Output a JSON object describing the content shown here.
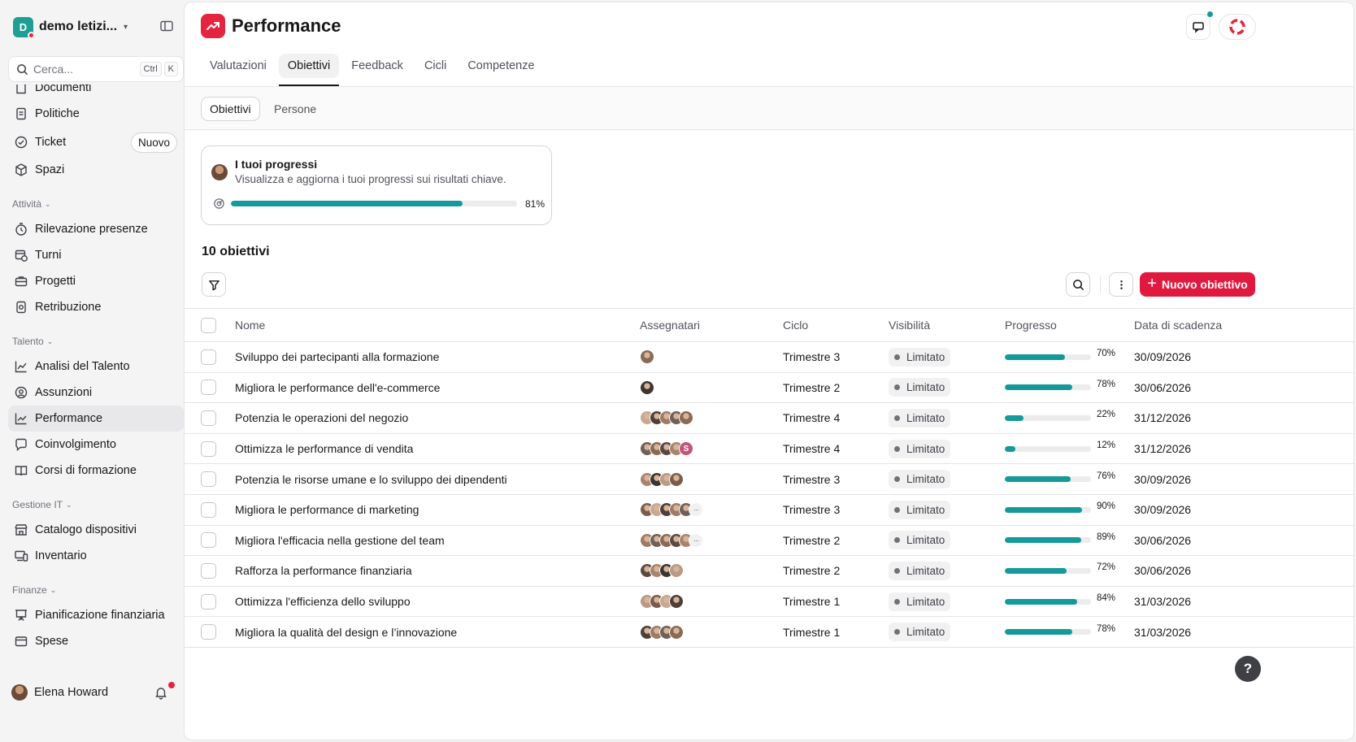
{
  "workspace": {
    "initial": "D",
    "name": "demo letizi..."
  },
  "search": {
    "placeholder": "Cerca...",
    "kbd1": "Ctrl",
    "kbd2": "K"
  },
  "sidebar": {
    "items": [
      {
        "label": "Documenti",
        "icon": "document-icon"
      },
      {
        "label": "Politiche",
        "icon": "policy-icon"
      },
      {
        "label": "Ticket",
        "icon": "check-circle-icon",
        "badge": "Nuovo"
      },
      {
        "label": "Spazi",
        "icon": "cube-icon"
      },
      {
        "label": "Rilevazione presenze",
        "icon": "timer-icon"
      },
      {
        "label": "Turni",
        "icon": "calendar-clock-icon"
      },
      {
        "label": "Progetti",
        "icon": "briefcase-icon"
      },
      {
        "label": "Retribuzione",
        "icon": "money-icon"
      },
      {
        "label": "Analisi del Talento",
        "icon": "chart-line-icon"
      },
      {
        "label": "Assunzioni",
        "icon": "user-search-icon"
      },
      {
        "label": "Performance",
        "icon": "trend-icon"
      },
      {
        "label": "Coinvolgimento",
        "icon": "chat-heart-icon"
      },
      {
        "label": "Corsi di formazione",
        "icon": "book-icon"
      },
      {
        "label": "Catalogo dispositivi",
        "icon": "store-icon"
      },
      {
        "label": "Inventario",
        "icon": "devices-icon"
      },
      {
        "label": "Pianificazione finanziaria",
        "icon": "presentation-icon"
      },
      {
        "label": "Spese",
        "icon": "wallet-icon"
      }
    ],
    "sections": {
      "attivita": "Attività",
      "talento": "Talento",
      "gestione_it": "Gestione IT",
      "finanze": "Finanze"
    }
  },
  "user": {
    "name": "Elena Howard"
  },
  "header": {
    "title": "Performance",
    "tabs": [
      "Valutazioni",
      "Obiettivi",
      "Feedback",
      "Cicli",
      "Competenze"
    ],
    "active_tab": "Obiettivi"
  },
  "subtabs": [
    "Obiettivi",
    "Persone"
  ],
  "progress_card": {
    "title": "I tuoi progressi",
    "subtitle": "Visualizza e aggiorna i tuoi progressi sui risultati chiave.",
    "percent": 81,
    "percent_label": "81%"
  },
  "count_label": "10 obiettivi",
  "new_button_label": "Nuovo obiettivo",
  "colors": {
    "accent": "#e01a3f",
    "progress": "#159a99"
  },
  "table": {
    "columns": [
      "Nome",
      "Assegnatari",
      "Ciclo",
      "Visibilità",
      "Progresso",
      "Data di scadenza"
    ],
    "rows": [
      {
        "name": "Sviluppo dei partecipanti alla formazione",
        "assignees": [
          "p1"
        ],
        "cycle": "Trimestre 3",
        "visibility": "Limitato",
        "progress": 70,
        "progress_label": "70%",
        "due": "30/09/2026"
      },
      {
        "name": "Migliora le performance dell'e-commerce",
        "assignees": [
          "p2"
        ],
        "cycle": "Trimestre 2",
        "visibility": "Limitato",
        "progress": 78,
        "progress_label": "78%",
        "due": "30/06/2026"
      },
      {
        "name": "Potenzia le operazioni del negozio",
        "assignees": [
          "p3",
          "p4",
          "p5",
          "p6",
          "p7"
        ],
        "cycle": "Trimestre 4",
        "visibility": "Limitato",
        "progress": 22,
        "progress_label": "22%",
        "due": "31/12/2026"
      },
      {
        "name": "Ottimizza le performance di vendita",
        "assignees": [
          "p8",
          "p9",
          "p10",
          "p11",
          "S"
        ],
        "cycle": "Trimestre 4",
        "visibility": "Limitato",
        "progress": 12,
        "progress_label": "12%",
        "due": "31/12/2026"
      },
      {
        "name": "Potenzia le risorse umane e lo sviluppo dei dipendenti",
        "assignees": [
          "p12",
          "p13",
          "p14",
          "p15"
        ],
        "cycle": "Trimestre 3",
        "visibility": "Limitato",
        "progress": 76,
        "progress_label": "76%",
        "due": "30/09/2026"
      },
      {
        "name": "Migliora le performance di marketing",
        "assignees": [
          "p16",
          "p17",
          "p18",
          "p19",
          "p20",
          "..."
        ],
        "cycle": "Trimestre 3",
        "visibility": "Limitato",
        "progress": 90,
        "progress_label": "90%",
        "due": "30/09/2026"
      },
      {
        "name": "Migliora l'efficacia nella gestione del team",
        "assignees": [
          "p21",
          "p22",
          "p23",
          "p24",
          "p25",
          "..."
        ],
        "cycle": "Trimestre 2",
        "visibility": "Limitato",
        "progress": 89,
        "progress_label": "89%",
        "due": "30/06/2026"
      },
      {
        "name": "Rafforza la performance finanziaria",
        "assignees": [
          "p26",
          "p27",
          "p28",
          "p29"
        ],
        "cycle": "Trimestre 2",
        "visibility": "Limitato",
        "progress": 72,
        "progress_label": "72%",
        "due": "30/06/2026"
      },
      {
        "name": "Ottimizza l'efficienza dello sviluppo",
        "assignees": [
          "p30",
          "p31",
          "p32",
          "p33"
        ],
        "cycle": "Trimestre 1",
        "visibility": "Limitato",
        "progress": 84,
        "progress_label": "84%",
        "due": "31/03/2026"
      },
      {
        "name": "Migliora la qualità del design e l’innovazione",
        "assignees": [
          "p34",
          "p35",
          "p36",
          "p37"
        ],
        "cycle": "Trimestre 1",
        "visibility": "Limitato",
        "progress": 78,
        "progress_label": "78%",
        "due": "31/03/2026"
      }
    ]
  },
  "help_label": "?"
}
